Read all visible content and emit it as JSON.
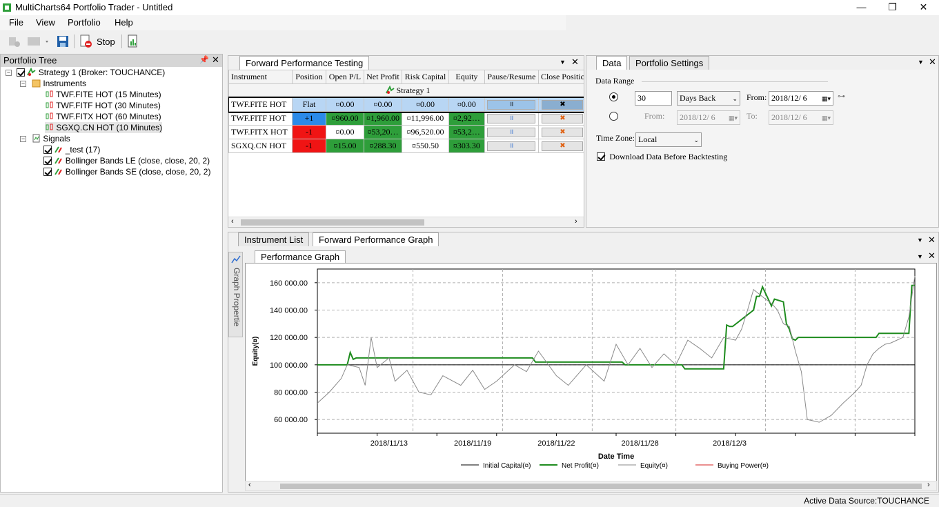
{
  "window": {
    "title": "MultiCharts64 Portfolio Trader - Untitled",
    "minimize": "—",
    "maximize": "❐",
    "close": "✕"
  },
  "menu": [
    "File",
    "View",
    "Portfolio",
    "Help"
  ],
  "toolbar": {
    "stop_label": "Stop"
  },
  "portfolio_tree": {
    "title": "Portfolio Tree",
    "strategy": "Strategy 1 (Broker: TOUCHANCE)",
    "instruments_label": "Instruments",
    "instruments": [
      "TWF.FITE HOT (15 Minutes)",
      "TWF.FITF HOT (30 Minutes)",
      "TWF.FITX HOT (60 Minutes)",
      "SGXQ.CN HOT (10 Minutes)"
    ],
    "signals_label": "Signals",
    "signals": [
      "_test (17)",
      "Bollinger Bands LE (close,  close,  20,  2)",
      "Bollinger Bands SE (close,  close,  20,  2)"
    ]
  },
  "fpt": {
    "tab": "Forward Performance Testing",
    "columns": [
      "Instrument",
      "Position",
      "Open P/L",
      "Net Profit",
      "Risk Capital",
      "Equity",
      "Pause/Resume",
      "Close Positic"
    ],
    "group_label": "Strategy 1",
    "rows": [
      {
        "instrument": "TWF.FITE HOT",
        "position": "Flat",
        "open_pl": "¤0.00",
        "net_profit": "¤0.00",
        "risk_capital": "¤0.00",
        "equity": "¤0.00"
      },
      {
        "instrument": "TWF.FITF HOT",
        "position": "+1",
        "open_pl": "¤960.00",
        "net_profit": "¤1,960.00",
        "risk_capital": "¤11,996.00",
        "equity": "¤2,92…"
      },
      {
        "instrument": "TWF.FITX HOT",
        "position": "-1",
        "open_pl": "¤0.00",
        "net_profit": "¤53,20…",
        "risk_capital": "¤96,520.00",
        "equity": "¤53,2…"
      },
      {
        "instrument": "SGXQ.CN HOT",
        "position": "-1",
        "open_pl": "¤15.00",
        "net_profit": "¤288.30",
        "risk_capital": "¤550.50",
        "equity": "¤303.30"
      }
    ],
    "pause_glyph": "॥",
    "close_glyph": "✖"
  },
  "data_panel": {
    "tabs": [
      "Data",
      "Portfolio Settings"
    ],
    "data_range_label": "Data Range",
    "days_value": "30",
    "days_mode": "Days Back",
    "from_label": "From:",
    "from_value": "2018/12/  6",
    "from2_label": "From:",
    "from2_value": "2018/12/  6",
    "to_label": "To:",
    "to_value": "2018/12/  6",
    "timezone_label": "Time Zone:",
    "timezone_value": "Local",
    "download_label": "Download Data Before Backtesting"
  },
  "bottom": {
    "tabs": [
      "Instrument List",
      "Forward Performance Graph"
    ],
    "inner_tab": "Performance Graph",
    "side_label": "Graph Propertie"
  },
  "chart_data": {
    "type": "line",
    "title": "",
    "xlabel": "Date Time",
    "ylabel": "Equity(¤)",
    "ylim": [
      50000,
      170000
    ],
    "y_ticks": [
      "60 000.00",
      "80 000.00",
      "100 000.00",
      "120 000.00",
      "140 000.00",
      "160 000.00"
    ],
    "y_tick_values": [
      60000,
      80000,
      100000,
      120000,
      140000,
      160000
    ],
    "x_ticks": [
      "2018/11/13",
      "2018/11/19",
      "2018/11/22",
      "2018/11/28",
      "2018/12/3"
    ],
    "grid": true,
    "legend": "bottom",
    "series": [
      {
        "name": "Initial Capital(¤)",
        "color": "#000000",
        "x": [
          0,
          100
        ],
        "values": [
          100000,
          100000
        ]
      },
      {
        "name": "Net Profit(¤)",
        "color": "#1e8c1e",
        "x": [
          0,
          5,
          5.5,
          6,
          6.5,
          36,
          36.5,
          51,
          51.5,
          61,
          61.5,
          68,
          68.5,
          69,
          69.5,
          73,
          73.5,
          74,
          74.5,
          76,
          76.5,
          78,
          78.5,
          79,
          79.5,
          80,
          80.5,
          93.5,
          94,
          99,
          99.5,
          100
        ],
        "values": [
          100000,
          100000,
          109000,
          104000,
          105000,
          105000,
          102000,
          102000,
          100000,
          100000,
          97000,
          97000,
          129000,
          128000,
          128000,
          140000,
          150000,
          150000,
          157000,
          143000,
          148000,
          146000,
          130000,
          126000,
          119000,
          118000,
          120000,
          120000,
          123000,
          123000,
          158000,
          158000
        ]
      },
      {
        "name": "Equity(¤)",
        "color": "#8a8a8a",
        "x": [
          0,
          2,
          4,
          5,
          7,
          8,
          9,
          10,
          12,
          13,
          15,
          17,
          19,
          21,
          24,
          26,
          28,
          30,
          33,
          35,
          37,
          40,
          42,
          45,
          48,
          50,
          52,
          54,
          56,
          58,
          60,
          62,
          64,
          66,
          68,
          70,
          71,
          72,
          73,
          75,
          76,
          77,
          78,
          79,
          80,
          81,
          82,
          84,
          86,
          88,
          90,
          91,
          92,
          93,
          94,
          95,
          96,
          97,
          98,
          99,
          100
        ],
        "values": [
          72000,
          80000,
          90000,
          100000,
          98000,
          85000,
          120000,
          98000,
          105000,
          88000,
          96000,
          80000,
          78000,
          92000,
          85000,
          96000,
          82000,
          88000,
          100000,
          95000,
          110000,
          92000,
          85000,
          100000,
          88000,
          115000,
          100000,
          112000,
          98000,
          108000,
          100000,
          118000,
          112000,
          105000,
          120000,
          118000,
          126000,
          140000,
          155000,
          148000,
          145000,
          140000,
          130000,
          128000,
          110000,
          95000,
          60000,
          58000,
          63000,
          72000,
          80000,
          85000,
          100000,
          108000,
          112000,
          115000,
          116000,
          118000,
          120000,
          135000,
          165000
        ]
      },
      {
        "name": "Buying Power(¤)",
        "color": "#d42020",
        "x": [],
        "values": []
      }
    ]
  },
  "status": {
    "text": "Active Data Source:TOUCHANCE"
  }
}
